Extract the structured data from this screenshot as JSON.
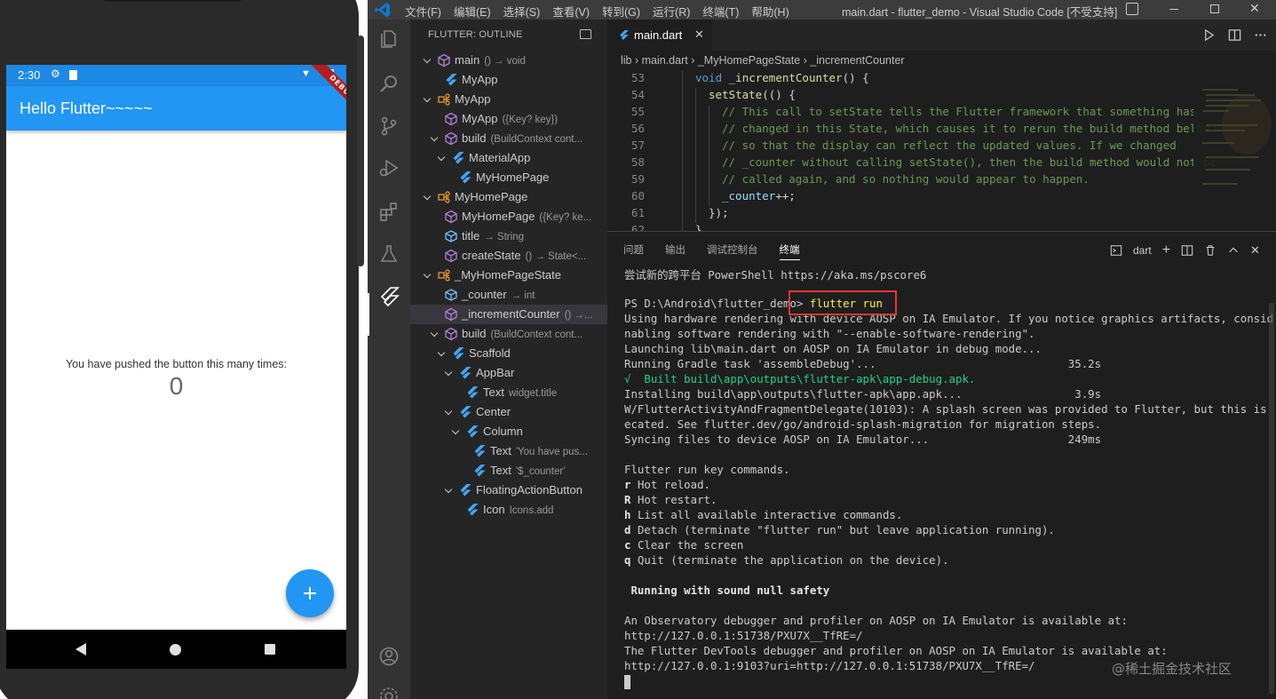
{
  "phone": {
    "status_time": "2:30",
    "app_title": "Hello Flutter~~~~~",
    "debug_banner": "DEBUG",
    "body_text": "You have pushed the button this many times:",
    "counter": "0",
    "fab_icon": "add-icon"
  },
  "vscode": {
    "menu": [
      "文件(F)",
      "编辑(E)",
      "选择(S)",
      "查看(V)",
      "转到(G)",
      "运行(R)",
      "终端(T)",
      "帮助(H)"
    ],
    "window_title": "main.dart - flutter_demo - Visual Studio Code [不受支持]",
    "sidebar_title": "FLUTTER: OUTLINE",
    "outline": [
      {
        "label": "main",
        "detail": "() → void",
        "depth": 0,
        "chevron": "down",
        "icon": "method-icon"
      },
      {
        "label": "MyApp",
        "detail": "",
        "depth": 1,
        "chevron": "",
        "icon": "flutter-widget-icon"
      },
      {
        "label": "MyApp",
        "detail": "",
        "depth": 0,
        "chevron": "down",
        "icon": "class-icon"
      },
      {
        "label": "MyApp",
        "detail": "({Key? key})",
        "depth": 1,
        "chevron": "",
        "icon": "method-icon"
      },
      {
        "label": "build",
        "detail": "(BuildContext cont...",
        "depth": 1,
        "chevron": "down",
        "icon": "method-icon"
      },
      {
        "label": "MaterialApp",
        "detail": "",
        "depth": 2,
        "chevron": "down",
        "icon": "flutter-widget-icon"
      },
      {
        "label": "MyHomePage",
        "detail": "",
        "depth": 3,
        "chevron": "",
        "icon": "flutter-widget-icon"
      },
      {
        "label": "MyHomePage",
        "detail": "",
        "depth": 0,
        "chevron": "down",
        "icon": "class-icon"
      },
      {
        "label": "MyHomePage",
        "detail": "({Key? ke...",
        "depth": 1,
        "chevron": "",
        "icon": "method-icon"
      },
      {
        "label": "title",
        "detail": "→ String",
        "depth": 1,
        "chevron": "",
        "icon": "field-icon"
      },
      {
        "label": "createState",
        "detail": "() → State<...",
        "depth": 1,
        "chevron": "",
        "icon": "method-icon"
      },
      {
        "label": "_MyHomePageState",
        "detail": "",
        "depth": 0,
        "chevron": "down",
        "icon": "class-icon"
      },
      {
        "label": "_counter",
        "detail": "→ int",
        "depth": 1,
        "chevron": "",
        "icon": "field-icon"
      },
      {
        "label": "_incrementCounter",
        "detail": "() →...",
        "depth": 1,
        "chevron": "",
        "icon": "method-icon",
        "selected": true
      },
      {
        "label": "build",
        "detail": "(BuildContext cont...",
        "depth": 1,
        "chevron": "down",
        "icon": "method-icon"
      },
      {
        "label": "Scaffold",
        "detail": "",
        "depth": 2,
        "chevron": "down",
        "icon": "flutter-widget-icon"
      },
      {
        "label": "AppBar",
        "detail": "",
        "depth": 3,
        "chevron": "down",
        "icon": "flutter-widget-icon"
      },
      {
        "label": "Text",
        "detail": "widget.title",
        "depth": 4,
        "chevron": "",
        "icon": "flutter-widget-icon"
      },
      {
        "label": "Center",
        "detail": "",
        "depth": 3,
        "chevron": "down",
        "icon": "flutter-widget-icon"
      },
      {
        "label": "Column",
        "detail": "",
        "depth": 4,
        "chevron": "down",
        "icon": "flutter-widget-icon"
      },
      {
        "label": "Text",
        "detail": "'You have pus...",
        "depth": 5,
        "chevron": "",
        "icon": "flutter-widget-icon"
      },
      {
        "label": "Text",
        "detail": "'$_counter'",
        "depth": 5,
        "chevron": "",
        "icon": "flutter-widget-icon"
      },
      {
        "label": "FloatingActionButton",
        "detail": "",
        "depth": 3,
        "chevron": "down",
        "icon": "flutter-widget-icon"
      },
      {
        "label": "Icon",
        "detail": "Icons.add",
        "depth": 4,
        "chevron": "",
        "icon": "flutter-widget-icon"
      }
    ],
    "tab_label": "main.dart",
    "breadcrumb": "lib  ›  main.dart  ›  _MyHomePageState  ›  _incrementCounter",
    "code_lines": [
      {
        "no": "53",
        "indent": 1,
        "tokens": [
          [
            "kw",
            "void "
          ],
          [
            "fn",
            "_incrementCounter"
          ],
          [
            "pn",
            "() {"
          ]
        ]
      },
      {
        "no": "54",
        "indent": 2,
        "tokens": [
          [
            "fn",
            "setState"
          ],
          [
            "pn",
            "(() {"
          ]
        ]
      },
      {
        "no": "55",
        "indent": 3,
        "tokens": [
          [
            "cm",
            "// This call to setState tells the Flutter framework that something has"
          ]
        ]
      },
      {
        "no": "56",
        "indent": 3,
        "tokens": [
          [
            "cm",
            "// changed in this State, which causes it to rerun the build method below"
          ]
        ]
      },
      {
        "no": "57",
        "indent": 3,
        "tokens": [
          [
            "cm",
            "// so that the display can reflect the updated values. If we changed"
          ]
        ]
      },
      {
        "no": "58",
        "indent": 3,
        "tokens": [
          [
            "cm",
            "// _counter without calling setState(), then the build method would not be"
          ]
        ]
      },
      {
        "no": "59",
        "indent": 3,
        "tokens": [
          [
            "cm",
            "// called again, and so nothing would appear to happen."
          ]
        ]
      },
      {
        "no": "60",
        "indent": 3,
        "tokens": [
          [
            "id",
            "_counter"
          ],
          [
            "pn",
            "++;"
          ]
        ]
      },
      {
        "no": "61",
        "indent": 2,
        "tokens": [
          [
            "pn",
            "});"
          ]
        ]
      },
      {
        "no": "62",
        "indent": 1,
        "tokens": [
          [
            "pn",
            "}"
          ]
        ]
      }
    ],
    "panel_tabs": [
      "问题",
      "输出",
      "调试控制台",
      "终端"
    ],
    "panel_active_tab": "终端",
    "terminal_shell": "dart",
    "terminal_lines": [
      {
        "text": "尝试新的跨平台 PowerShell https://aka.ms/pscore6",
        "style": ""
      },
      {
        "text": "",
        "style": "spacer"
      },
      {
        "text": "PS D:\\Android\\flutter_demo> ",
        "style": "prompt",
        "cmd": "flutter run"
      },
      {
        "text": "Using hardware rendering with device AOSP on IA Emulator. If you notice graphics artifacts, consider e",
        "style": ""
      },
      {
        "text": "nabling software rendering with \"--enable-software-rendering\".",
        "style": ""
      },
      {
        "text": "Launching lib\\main.dart on AOSP on IA Emulator in debug mode...",
        "style": ""
      },
      {
        "text": "Running Gradle task 'assembleDebug'...                             35.2s",
        "style": ""
      },
      {
        "text": "√  Built build\\app\\outputs\\flutter-apk\\app-debug.apk.",
        "style": "green"
      },
      {
        "text": "Installing build\\app\\outputs\\flutter-apk\\app.apk...                 3.9s",
        "style": ""
      },
      {
        "text": "W/FlutterActivityAndFragmentDelegate(10103): A splash screen was provided to Flutter, but this is depr",
        "style": ""
      },
      {
        "text": "ecated. See flutter.dev/go/android-splash-migration for migration steps.",
        "style": ""
      },
      {
        "text": "Syncing files to device AOSP on IA Emulator...                     249ms",
        "style": ""
      },
      {
        "text": "",
        "style": "spacer"
      },
      {
        "text": "Flutter run key commands.",
        "style": ""
      },
      {
        "text": "Hot reload.",
        "style": "key",
        "key": "r"
      },
      {
        "text": "Hot restart.",
        "style": "key",
        "key": "R"
      },
      {
        "text": "List all available interactive commands.",
        "style": "key",
        "key": "h"
      },
      {
        "text": "Detach (terminate \"flutter run\" but leave application running).",
        "style": "key",
        "key": "d"
      },
      {
        "text": "Clear the screen",
        "style": "key",
        "key": "c"
      },
      {
        "text": "Quit (terminate the application on the device).",
        "style": "key",
        "key": "q"
      },
      {
        "text": "",
        "style": "spacer"
      },
      {
        "text": " Running with sound null safety",
        "style": "bold"
      },
      {
        "text": "",
        "style": "spacer"
      },
      {
        "text": "An Observatory debugger and profiler on AOSP on IA Emulator is available at:",
        "style": ""
      },
      {
        "text": "http://127.0.0.1:51738/PXU7X__TfRE=/",
        "style": ""
      },
      {
        "text": "The Flutter DevTools debugger and profiler on AOSP on IA Emulator is available at:",
        "style": ""
      },
      {
        "text": "http://127.0.0.1:9103?uri=http://127.0.0.1:51738/PXU7X__TfRE=/",
        "style": ""
      },
      {
        "text": "",
        "style": "cursor"
      }
    ],
    "watermark": "@稀土掘金技术社区",
    "colors": {
      "highlight": "#e53935",
      "accent": "#2196f3"
    }
  }
}
